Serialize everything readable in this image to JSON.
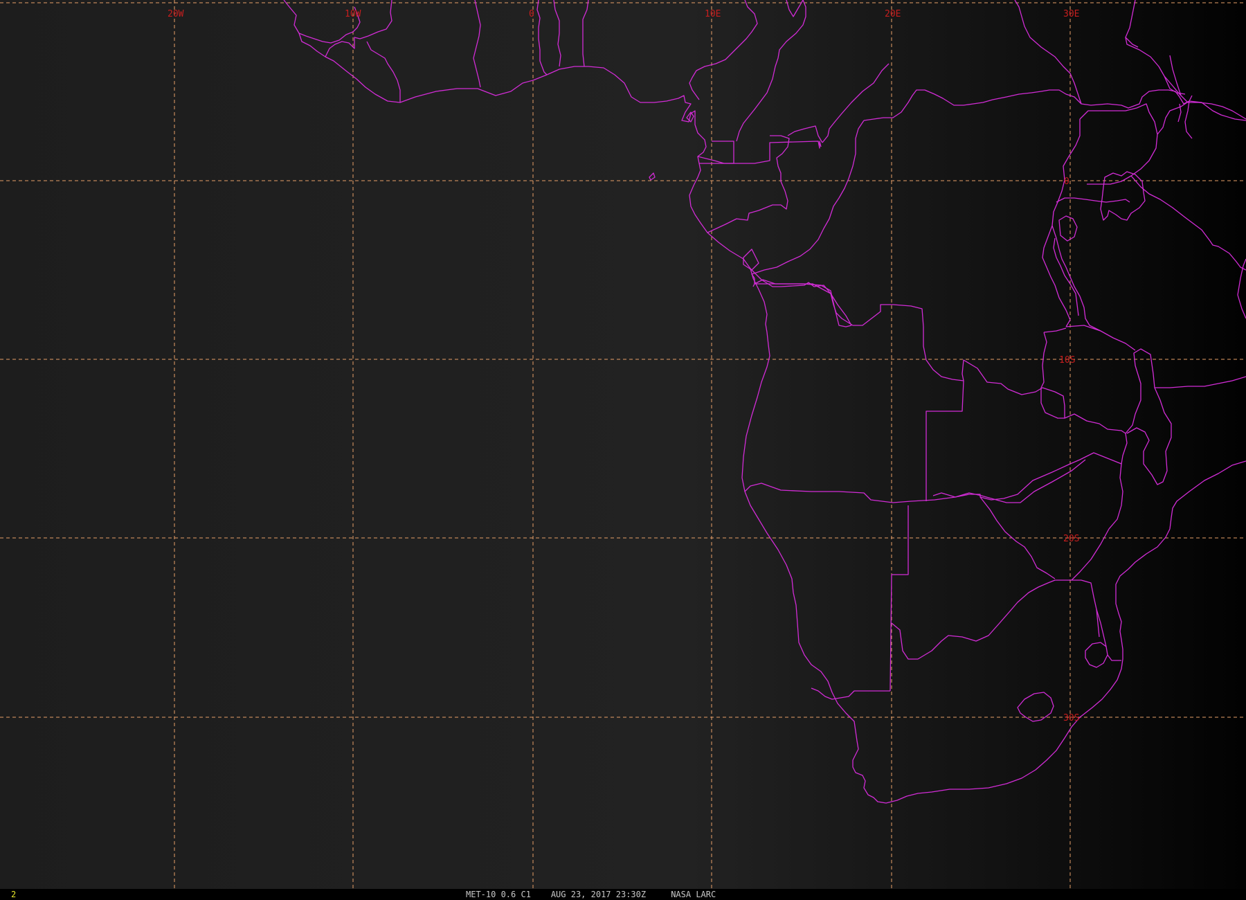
{
  "image": {
    "caption": "MET-10 0.6 C1    AUG 23, 2017 23:30Z     NASA LARC",
    "frame_number": "2"
  },
  "map_labels": {
    "lon_20w": "20W",
    "lon_10w": "10W",
    "lon_0": "0",
    "lon_10e": "10E",
    "lon_20e": "20E",
    "lon_30e": "30E",
    "lat_0": "0",
    "lat_10s": "10S",
    "lat_20s": "20S",
    "lat_30s": "30S"
  },
  "colors": {
    "background": "#1e1e1e",
    "borders": "#d22cd6",
    "gridlines": "#e8a068",
    "grid_labels": "#c81e1e",
    "frame_number": "#e6e62a",
    "caption": "#c8c8c8"
  }
}
